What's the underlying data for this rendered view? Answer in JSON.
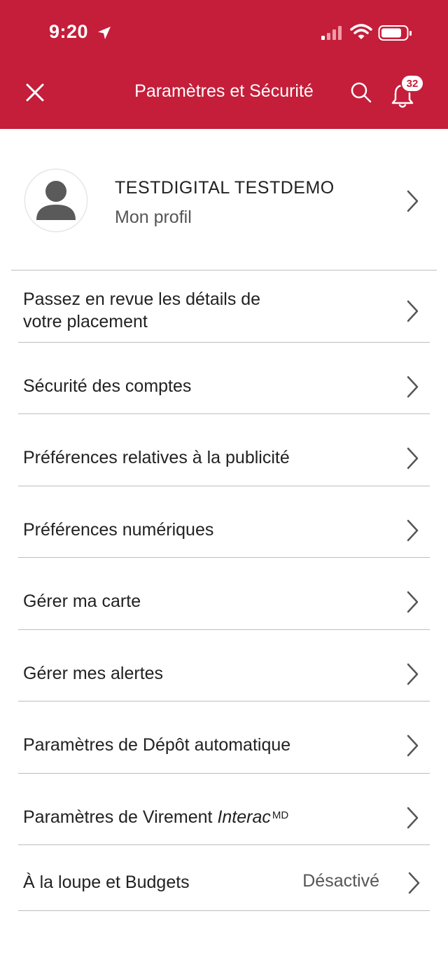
{
  "status_bar": {
    "time": "9:20",
    "icons": [
      "location-arrow-icon",
      "signal-icon",
      "wifi-icon",
      "battery-icon"
    ]
  },
  "nav": {
    "title": "Paramètres et Sécurité",
    "notifications_count": "32",
    "icons": [
      "close-icon",
      "search-icon",
      "bell-icon"
    ]
  },
  "profile": {
    "name": "TESTDIGITAL TESTDEMO",
    "subtitle": "Mon profil",
    "icon": "user-avatar-icon"
  },
  "menu": {
    "items": [
      {
        "line1": "Passez en revue les détails de",
        "line2": "votre placement"
      },
      {
        "label": "Sécurité des comptes"
      },
      {
        "label": "Préférences relatives à la publicité"
      },
      {
        "label": "Préférences numériques"
      },
      {
        "label": "Gérer ma carte"
      },
      {
        "label": "Gérer mes alertes"
      },
      {
        "label": "Paramètres de Dépôt automatique"
      },
      {
        "label_prefix": "Paramètres de Virement ",
        "label_italic": "Interac",
        "label_sup": "MD"
      },
      {
        "label": "À la loupe et Budgets",
        "value": "Désactivé"
      }
    ]
  },
  "colors": {
    "brand_red": "#c41e3a",
    "divider": "#bdbdbd",
    "text_primary": "#222222",
    "text_secondary": "#555555"
  }
}
